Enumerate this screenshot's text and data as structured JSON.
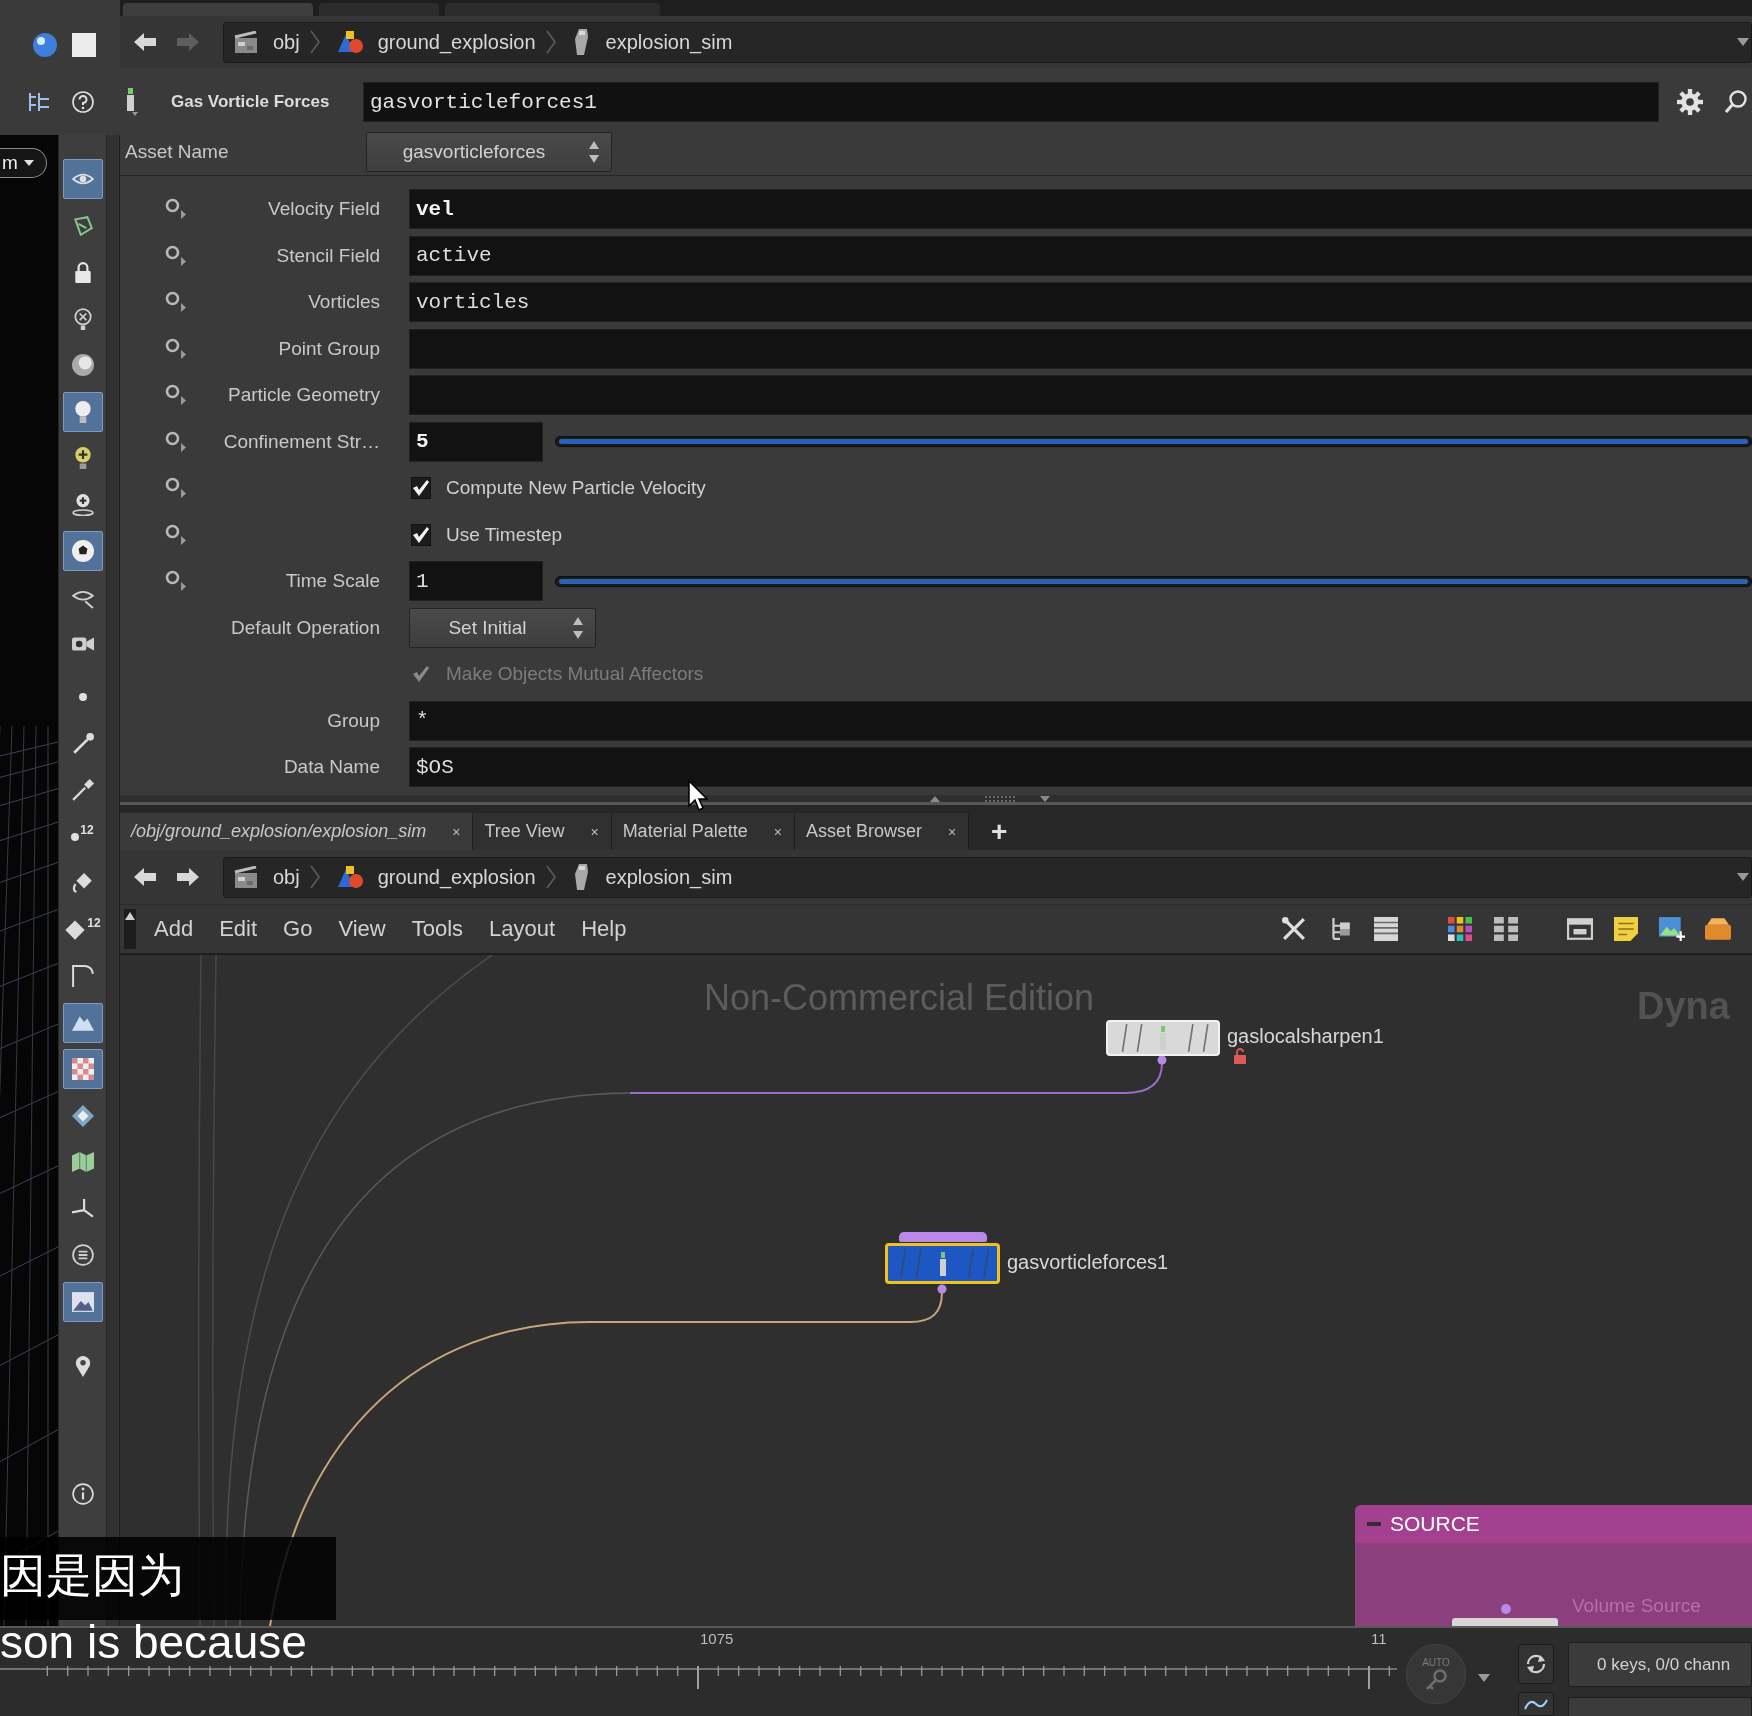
{
  "top_tabs": [
    {
      "selected": true
    },
    {
      "selected": false
    },
    {
      "selected": false
    }
  ],
  "viewport_menu": {
    "label": "m"
  },
  "toolbar": {
    "tools": [
      {
        "selected": true
      },
      {
        "selected": false
      },
      {
        "selected": false
      },
      {
        "selected": false
      },
      {
        "selected": false
      },
      {
        "selected": true
      },
      {
        "selected": false
      },
      {
        "selected": false
      },
      {
        "selected": true
      },
      {
        "selected": false
      },
      {
        "selected": false
      },
      {
        "selected": false
      },
      {
        "selected": false
      },
      {
        "selected": false
      },
      {
        "selected": false,
        "badge": "12"
      },
      {
        "selected": false
      },
      {
        "selected": false,
        "badge": "12"
      },
      {
        "selected": false
      },
      {
        "selected": true
      },
      {
        "selected": true
      },
      {
        "selected": false
      },
      {
        "selected": false
      },
      {
        "selected": false
      },
      {
        "selected": false
      },
      {
        "selected": true
      },
      {
        "selected": false
      },
      {
        "selected": false
      }
    ]
  },
  "path_bar": {
    "forward_disabled": true,
    "crumbs": [
      {
        "kind": "obj",
        "label": "obj"
      },
      {
        "kind": "geo",
        "label": "ground_explosion"
      },
      {
        "kind": "dop",
        "label": "explosion_sim"
      }
    ]
  },
  "parameters": {
    "node_type": "Gas Vorticle Forces",
    "node_name": "gasvorticleforces1",
    "asset_label": "Asset Name",
    "asset_value": "gasvorticleforces",
    "rows": [
      {
        "kind": "string",
        "keyable": true,
        "label": "Velocity Field",
        "value": "vel",
        "modified": true
      },
      {
        "kind": "string",
        "keyable": true,
        "label": "Stencil Field",
        "value": "active",
        "modified": false
      },
      {
        "kind": "string",
        "keyable": true,
        "label": "Vorticles",
        "value": "vorticles",
        "modified": false
      },
      {
        "kind": "string",
        "keyable": true,
        "label": "Point Group",
        "modified": false
      },
      {
        "kind": "string",
        "keyable": true,
        "label": "Particle Geometry",
        "modified": false
      },
      {
        "kind": "number",
        "keyable": true,
        "label": "Confinement Str…",
        "value": "5",
        "modified": true,
        "level": 1
      },
      {
        "kind": "toggle",
        "keyable": true,
        "label": "Compute New Particle Velocity",
        "checked": true,
        "disabled": false
      },
      {
        "kind": "toggle",
        "keyable": true,
        "label": "Use Timestep",
        "checked": true,
        "disabled": false
      },
      {
        "kind": "number",
        "keyable": true,
        "label": "Time Scale",
        "value": "1",
        "modified": false,
        "level": 1
      },
      {
        "kind": "menu",
        "keyable": false,
        "label": "Default Operation",
        "value": "Set Initial"
      },
      {
        "kind": "toggle",
        "keyable": false,
        "label": "Make Objects Mutual Affectors",
        "checked": true,
        "disabled": true
      },
      {
        "kind": "string",
        "keyable": false,
        "label": "Group",
        "value": "*",
        "modified": false
      },
      {
        "kind": "string",
        "keyable": false,
        "label": "Data Name",
        "value": "$OS",
        "modified": false
      }
    ]
  },
  "pane_tabs": {
    "tabs": [
      {
        "label": "/obj/ground_explosion/explosion_sim",
        "selected": true,
        "close": "×"
      },
      {
        "label": "Tree View",
        "selected": false,
        "close": "×"
      },
      {
        "label": "Material Palette",
        "selected": false,
        "close": "×"
      },
      {
        "label": "Asset Browser",
        "selected": false,
        "close": "×"
      }
    ],
    "add": "+"
  },
  "network_path_bar": {
    "forward_disabled": false,
    "crumbs": [
      {
        "kind": "obj",
        "label": "obj"
      },
      {
        "kind": "geo",
        "label": "ground_explosion"
      },
      {
        "kind": "dop",
        "label": "explosion_sim"
      }
    ]
  },
  "network_menu": {
    "items": [
      "Add",
      "Edit",
      "Go",
      "View",
      "Tools",
      "Layout",
      "Help"
    ]
  },
  "network": {
    "edition_label": "Non-Commercial Edition",
    "context_label": "Dyna",
    "nodes": [
      {
        "name": "gaslocalsharpen1",
        "color": "#d9d9d9",
        "selected": false,
        "display_flag": false,
        "locked": true
      },
      {
        "name": "gasvorticleforces1",
        "color": "#1d57c4",
        "selected": true,
        "display_flag": true,
        "locked": false
      }
    ],
    "network_box": {
      "title": "SOURCE",
      "comment": "Volume Source"
    }
  },
  "timeline": {
    "frame_labels": [
      "1075",
      "11"
    ],
    "auto_key": "AUTO",
    "keys_readout": "0 keys, 0/0 chann"
  },
  "subtitles": [
    "因是因为",
    "son is because"
  ]
}
